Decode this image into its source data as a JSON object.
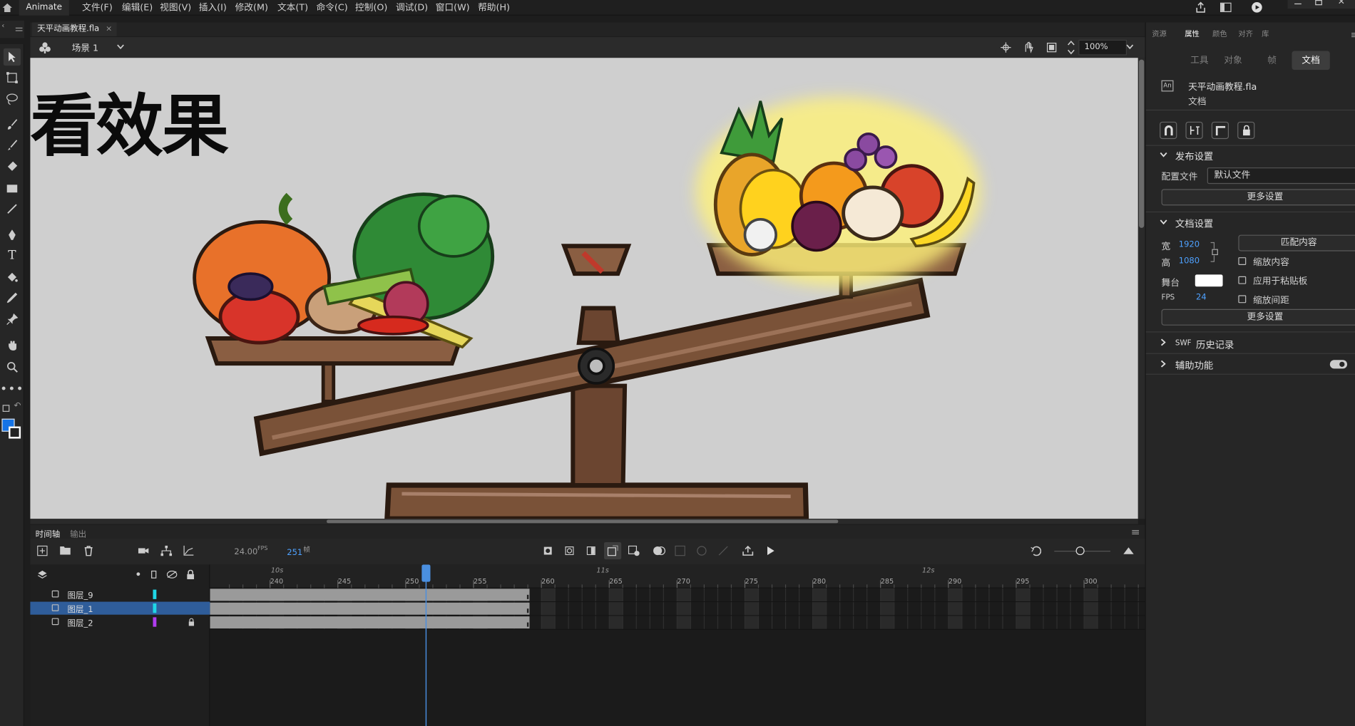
{
  "app": {
    "name": "Animate"
  },
  "menu": [
    "文件(F)",
    "编辑(E)",
    "视图(V)",
    "插入(I)",
    "修改(M)",
    "文本(T)",
    "命令(C)",
    "控制(O)",
    "调试(D)",
    "窗口(W)",
    "帮助(H)"
  ],
  "document_tab": {
    "filename": "天平动画教程.fla",
    "close": "×"
  },
  "scene": {
    "name": "场景 1",
    "zoom": "100%"
  },
  "stage_text": "看效果",
  "timeline": {
    "tabs": [
      "时间轴",
      "输出"
    ],
    "fps": "24.00",
    "fps_unit": "FPS",
    "current_frame": "251",
    "frame_unit": "帧",
    "seconds_labels": [
      "10s",
      "11s",
      "12s"
    ],
    "frame_numbers": [
      "240",
      "245",
      "250",
      "255",
      "260",
      "265",
      "270",
      "275",
      "280",
      "285",
      "290",
      "295",
      "300"
    ],
    "layers": [
      {
        "name": "图层_9",
        "color": "#1fd6e6",
        "locked": false,
        "selected": false
      },
      {
        "name": "图层_1",
        "color": "#1fd6e6",
        "locked": false,
        "selected": true
      },
      {
        "name": "图层_2",
        "color": "#b03cf0",
        "locked": true,
        "selected": false
      }
    ]
  },
  "right_panel": {
    "top_tabs": [
      "资源",
      "属性",
      "颜色",
      "对齐",
      "库"
    ],
    "sub_tabs": [
      "工具",
      "对象",
      "帧",
      "文档"
    ],
    "doc_icon": "An",
    "doc_name": "天平动画教程.fla",
    "doc_type": "文档",
    "publish": {
      "title": "发布设置",
      "profile_label": "配置文件",
      "profile_value": "默认文件",
      "more": "更多设置"
    },
    "doc_settings": {
      "title": "文档设置",
      "width_label": "宽",
      "width": "1920",
      "height_label": "高",
      "height": "1080",
      "stage_label": "舞台",
      "stage_color": "#ffffff",
      "fps_label": "FPS",
      "fps": "24",
      "match": "匹配内容",
      "scale_content": "缩放内容",
      "apply_pasteboard": "应用于粘贴板",
      "scale_spacing": "缩放间距",
      "more": "更多设置"
    },
    "swf_history": {
      "prefix": "SWF",
      "title": "历史记录"
    },
    "accessibility": "辅助功能"
  },
  "colors": {
    "accent": "#1473e6",
    "stage_bg": "#cfcfcf",
    "fill": "#1473e6",
    "stroke": "#222222"
  }
}
